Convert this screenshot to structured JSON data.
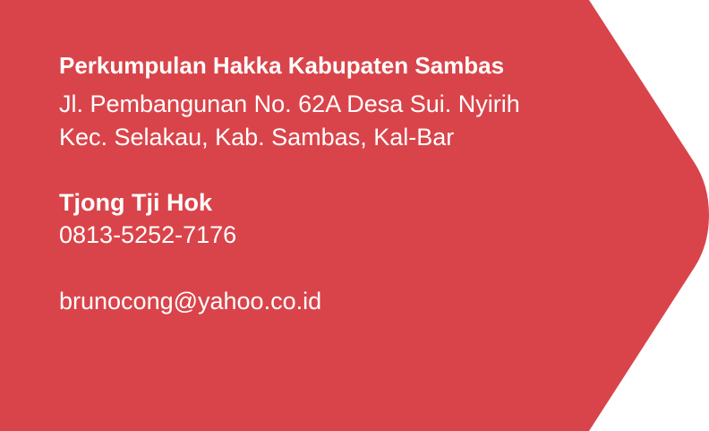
{
  "colors": {
    "card_background": "#d9444a",
    "text": "#ffffff"
  },
  "organization": {
    "name": "Perkumpulan Hakka Kabupaten Sambas",
    "address_line_1": "Jl. Pembangunan No. 62A Desa Sui. Nyirih",
    "address_line_2": "Kec. Selakau, Kab. Sambas, Kal-Bar"
  },
  "contact": {
    "name": "Tjong Tji Hok",
    "phone": "0813-5252-7176",
    "email": "brunocong@yahoo.co.id"
  }
}
